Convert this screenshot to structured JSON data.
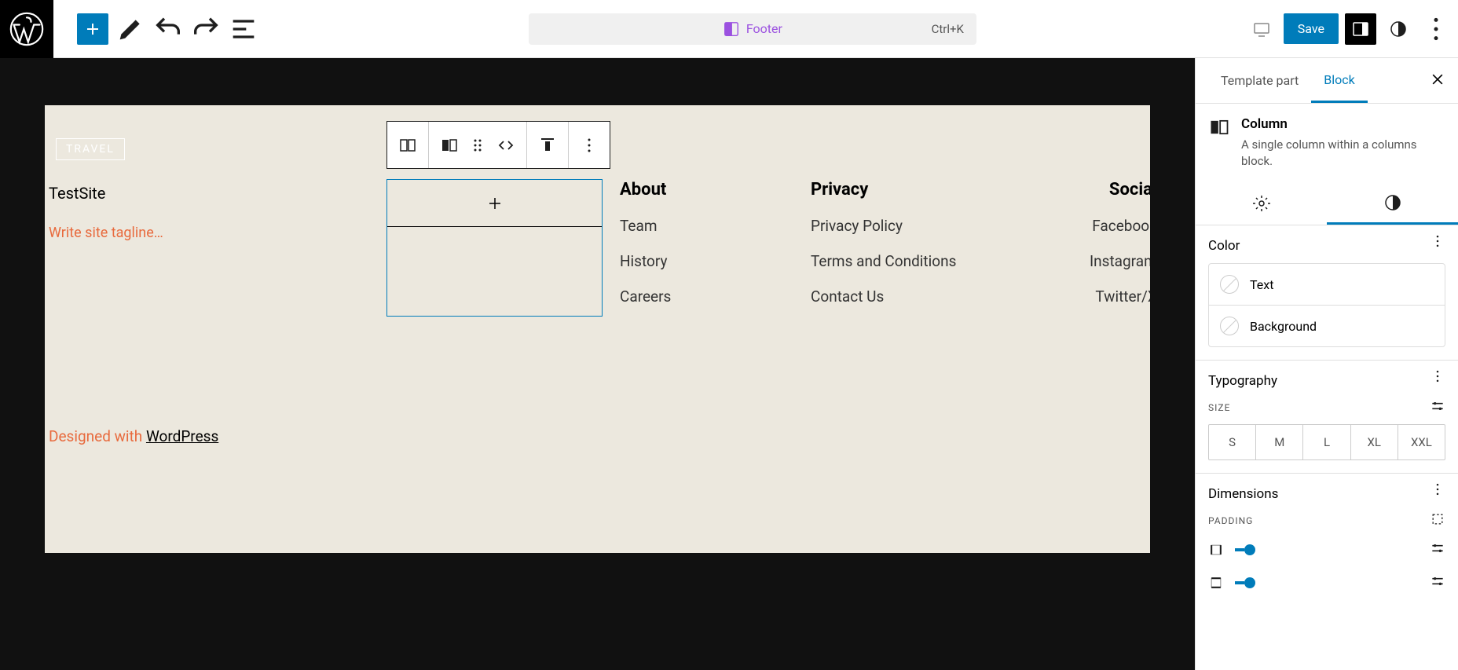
{
  "toolbar": {
    "center_label": "Footer",
    "shortcut": "Ctrl+K",
    "save": "Save"
  },
  "canvas": {
    "logo_text": "TRAVEL",
    "site_title": "TestSite",
    "tagline_placeholder": "Write site tagline…",
    "designed_prefix": "Designed with ",
    "designed_link": "WordPress"
  },
  "footer_cols": {
    "about": {
      "title": "About",
      "links": [
        "Team",
        "History",
        "Careers"
      ]
    },
    "privacy": {
      "title": "Privacy",
      "links": [
        "Privacy Policy",
        "Terms and Conditions",
        "Contact Us"
      ]
    },
    "social": {
      "title": "Social",
      "links": [
        "Facebook",
        "Instagram",
        "Twitter/X"
      ]
    }
  },
  "sidebar": {
    "tab_template": "Template part",
    "tab_block": "Block",
    "block_title": "Column",
    "block_desc": "A single column within a columns block.",
    "color": {
      "title": "Color",
      "text": "Text",
      "background": "Background"
    },
    "typography": {
      "title": "Typography",
      "size_label": "SIZE",
      "sizes": [
        "S",
        "M",
        "L",
        "XL",
        "XXL"
      ]
    },
    "dimensions": {
      "title": "Dimensions",
      "padding_label": "PADDING"
    }
  }
}
